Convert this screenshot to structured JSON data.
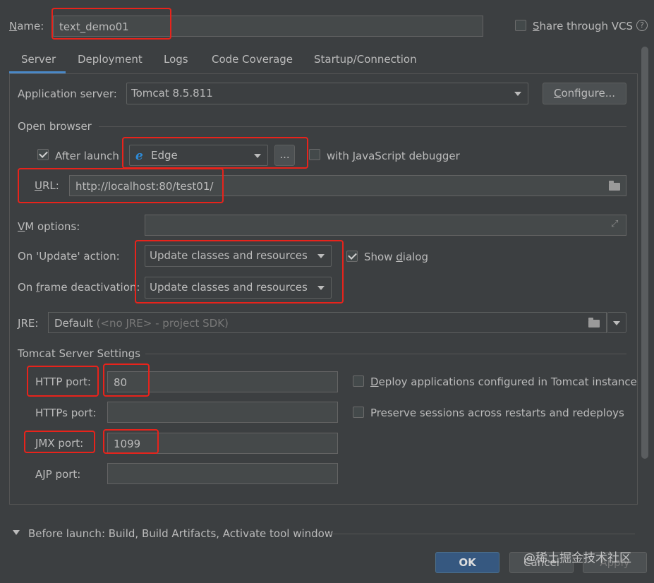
{
  "header": {
    "name_label_prefix": "N",
    "name_label_rest": "ame:",
    "name_value": "text_demo01",
    "share_vcs_underline": "S",
    "share_vcs_rest": "hare through VCS",
    "help_glyph": "?"
  },
  "tabs": [
    {
      "label": "Server"
    },
    {
      "label": "Deployment"
    },
    {
      "label": "Logs"
    },
    {
      "label": "Code Coverage"
    },
    {
      "label": "Startup/Connection"
    }
  ],
  "server": {
    "app_server_label": "Application server:",
    "app_server_value": "Tomcat 8.5.811",
    "configure_underline": "C",
    "configure_rest": "onfigure...",
    "open_browser_title": "Open browser",
    "after_launch_label": "After launch",
    "browser_value": "Edge",
    "browse_button": "...",
    "js_debugger_pre": "with ",
    "js_debugger_ul": "J",
    "js_debugger_rest": "avaScript debugger",
    "url_label_ul": "U",
    "url_label_rest": "RL:",
    "url_value": "http://localhost:80/test01/",
    "vm_label_ul": "V",
    "vm_label_rest": "M options:",
    "vm_value": "",
    "update_label": "On 'Update' action:",
    "update_value": "Update classes and resources",
    "show_dialog_pre": "Show ",
    "show_dialog_ul": "d",
    "show_dialog_rest": "ialog",
    "frame_label_pre": "On ",
    "frame_label_ul": "f",
    "frame_label_rest": "rame deactivation:",
    "frame_value": "Update classes and resources",
    "jre_label_ul": "J",
    "jre_label_rest": "RE:",
    "jre_value": "Default",
    "jre_hint": " (<no JRE> - project SDK)",
    "tomcat_title": "Tomcat Server Settings",
    "http_label": "HTTP port:",
    "http_value": "80",
    "https_label": "HTTPs port:",
    "https_value": "",
    "jmx_label": "JMX port:",
    "jmx_value": "1099",
    "ajp_label": "AJP port:",
    "ajp_value": "",
    "deploy_ul": "D",
    "deploy_rest": "eploy applications configured in Tomcat instance",
    "preserve_label": "Preserve sessions across restarts and redeploys"
  },
  "footer": {
    "before_launch": "Before launch: Build, Build Artifacts, Activate tool window",
    "ok": "OK",
    "cancel": "Cancel",
    "apply": "Apply",
    "watermark": "@稀土掘金技术社区"
  },
  "colors": {
    "background": "#3c3f41",
    "highlight": "#e8231b",
    "ok_button": "#365880",
    "tab_active": "#4a88c7"
  }
}
